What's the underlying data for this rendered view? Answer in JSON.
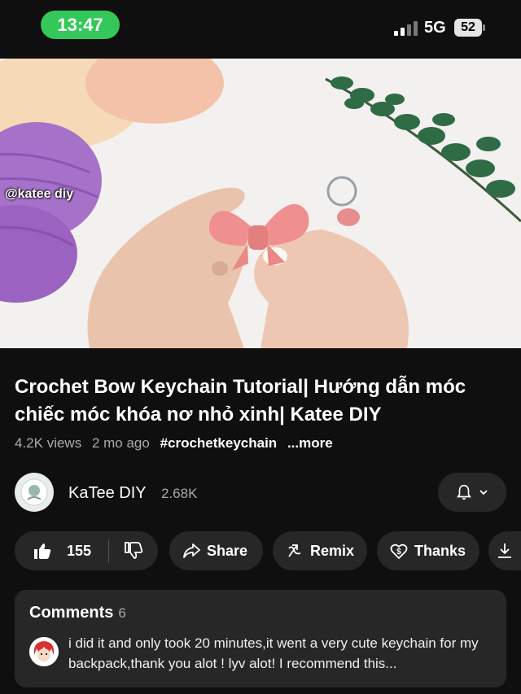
{
  "status_bar": {
    "time": "13:47",
    "network": "5G",
    "battery": "52"
  },
  "video": {
    "watermark": "@katee diy"
  },
  "title": "Crochet Bow Keychain Tutorial| Hướng dẫn móc chiếc móc khóa nơ nhỏ xinh| Katee DIY",
  "meta": {
    "views": "4.2K views",
    "age": "2 mo ago",
    "hashtag": "#crochetkeychain",
    "more": "...more"
  },
  "channel": {
    "name": "KaTee DIY",
    "subscribers": "2.68K"
  },
  "actions": {
    "likes": "155",
    "share": "Share",
    "remix": "Remix",
    "thanks": "Thanks"
  },
  "comments": {
    "header": "Comments",
    "count": "6",
    "top_comment": "i did it and only took 20 minutes,it went a very cute keychain for my backpack,thank you alot ! lyv alot! I recommend this..."
  },
  "colors": {
    "status_pill": "#34c759",
    "background": "#0f0f0f",
    "button": "#272727"
  },
  "icons": [
    "signal-icon",
    "battery-icon",
    "bell-icon",
    "chevron-down-icon",
    "like-icon",
    "dislike-icon",
    "share-icon",
    "remix-icon",
    "thanks-icon",
    "download-icon"
  ]
}
